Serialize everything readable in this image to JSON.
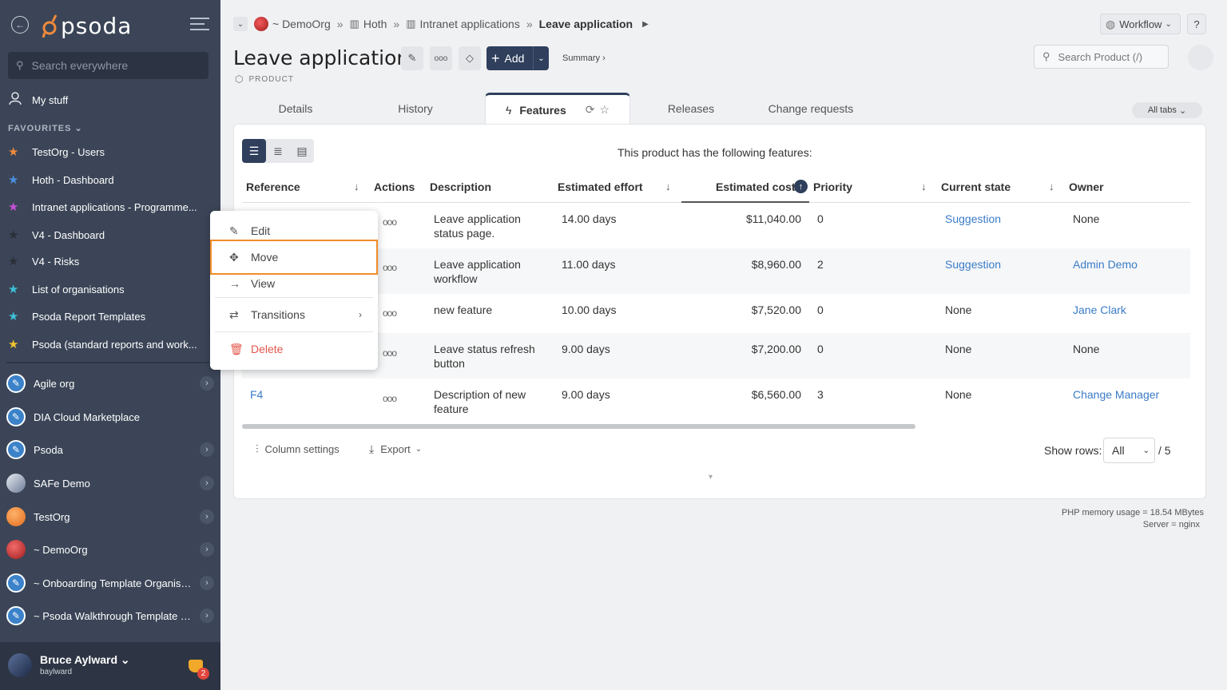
{
  "sidebar": {
    "logo_text": "psoda",
    "search_placeholder": "Search everywhere",
    "my_stuff": "My stuff",
    "favourites_header": "FAVOURITES",
    "favourites": [
      {
        "label": "TestOrg - Users",
        "color": "#f08a3c"
      },
      {
        "label": "Hoth - Dashboard",
        "color": "#4a90e2"
      },
      {
        "label": "Intranet applications - Programme...",
        "color": "#c651d6"
      },
      {
        "label": "V4 - Dashboard",
        "color": "#2a2f38"
      },
      {
        "label": "V4 - Risks",
        "color": "#2a2f38"
      },
      {
        "label": "List of organisations",
        "color": "#3cc0d8"
      },
      {
        "label": "Psoda Report Templates",
        "color": "#3cc0d8"
      },
      {
        "label": "Psoda (standard reports and work...",
        "color": "#f0c232"
      }
    ],
    "organisations": [
      {
        "label": "Agile org",
        "icon_color": "#3b82c9"
      },
      {
        "label": "DIA Cloud Marketplace",
        "icon_color": "#3b82c9"
      },
      {
        "label": "Psoda",
        "icon_color": "#3b82c9"
      },
      {
        "label": "SAFe Demo",
        "icon_color": "#9aa5b8"
      },
      {
        "label": "TestOrg",
        "icon_color": "#f08a3c"
      },
      {
        "label": "~ DemoOrg",
        "icon_color": "#d83a3a"
      },
      {
        "label": "~ Onboarding Template Organisa...",
        "icon_color": "#3b82c9"
      },
      {
        "label": "~ Psoda Walkthrough Template P...",
        "icon_color": "#3b82c9"
      }
    ],
    "user": {
      "name": "Bruce Aylward",
      "login": "baylward",
      "notification_count": "2"
    }
  },
  "breadcrumb": {
    "items": [
      "~ DemoOrg",
      "Hoth",
      "Intranet applications"
    ],
    "current": "Leave application"
  },
  "header": {
    "workflow_label": "Workflow",
    "help_label": "?",
    "title": "Leave application",
    "subtitle": "PRODUCT",
    "add_label": "Add",
    "summary_link": "Summary ›",
    "search_placeholder": "Search Product (/)"
  },
  "tabs": {
    "items": [
      "Details",
      "History",
      "Features",
      "Releases",
      "Change requests"
    ],
    "active": "Features",
    "all_tabs": "All tabs"
  },
  "panel": {
    "intro": "This product has the following features:"
  },
  "table": {
    "headers": [
      "Reference",
      "Actions",
      "Description",
      "Estimated effort",
      "Estimated cost",
      "Priority",
      "Current state",
      "Owner"
    ],
    "rows": [
      {
        "reference": "",
        "description": "Leave application status page.",
        "effort": "14.00 days",
        "cost": "$11,040.00",
        "priority": "0",
        "state": "Suggestion",
        "owner": "None"
      },
      {
        "reference": "",
        "description": "Leave application workflow",
        "effort": "11.00 days",
        "cost": "$8,960.00",
        "priority": "2",
        "state": "Suggestion",
        "owner": "Admin Demo"
      },
      {
        "reference": "",
        "description": "new feature",
        "effort": "10.00 days",
        "cost": "$7,520.00",
        "priority": "0",
        "state": "None",
        "owner": "Jane Clark"
      },
      {
        "reference": "",
        "description": "Leave status refresh button",
        "effort": "9.00 days",
        "cost": "$7,200.00",
        "priority": "0",
        "state": "None",
        "owner": "None"
      },
      {
        "reference": "F4",
        "description": "Description of new feature",
        "effort": "9.00 days",
        "cost": "$6,560.00",
        "priority": "3",
        "state": "None",
        "owner": "Change Manager"
      }
    ]
  },
  "footer_controls": {
    "column_settings": "Column settings",
    "export": "Export",
    "show_rows_label": "Show rows:",
    "show_rows_value": "All",
    "total": "/ 5"
  },
  "server_info": {
    "memory": "PHP memory usage = 18.54 MBytes",
    "server": "Server = nginx"
  },
  "context_menu": {
    "edit": "Edit",
    "move": "Move",
    "view": "View",
    "transitions": "Transitions",
    "delete": "Delete"
  }
}
